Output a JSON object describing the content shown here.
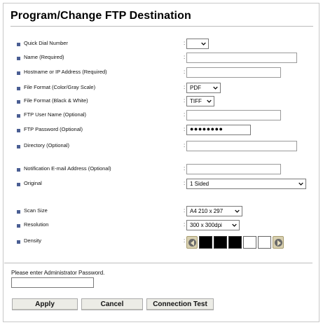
{
  "page": {
    "title": "Program/Change FTP Destination"
  },
  "fields": {
    "quick_dial": {
      "label": "Quick Dial Number",
      "value": ""
    },
    "name": {
      "label": "Name (Required)",
      "value": ""
    },
    "hostname": {
      "label": "Hostname or IP Address (Required)",
      "value": ""
    },
    "file_format_color": {
      "label": "File Format (Color/Gray Scale)",
      "value": "PDF"
    },
    "file_format_bw": {
      "label": "File Format (Black & White)",
      "value": "TIFF"
    },
    "ftp_user": {
      "label": "FTP User Name (Optional)",
      "value": ""
    },
    "ftp_password": {
      "label": "FTP Password (Optional)",
      "value": "●●●●●●●●"
    },
    "directory": {
      "label": "Directory (Optional)",
      "value": ""
    },
    "notification_email": {
      "label": "Notification E-mail Address (Optional)",
      "value": ""
    },
    "original": {
      "label": "Original",
      "value": "1 Sided"
    },
    "scan_size": {
      "label": "Scan Size",
      "value": "A4 210 x 297"
    },
    "resolution": {
      "label": "Resolution",
      "value": "300 x 300dpi"
    },
    "density": {
      "label": "Density",
      "cells": [
        "#000000",
        "#000000",
        "#000000",
        "#ffffff",
        "#ffffff"
      ]
    }
  },
  "admin": {
    "label": "Please enter Administrator Password.",
    "value": ""
  },
  "buttons": {
    "apply": "Apply",
    "cancel": "Cancel",
    "connection_test": "Connection Test"
  },
  "colors": {
    "bullet": "#4a5e93",
    "button_bg": "#ecece6"
  }
}
